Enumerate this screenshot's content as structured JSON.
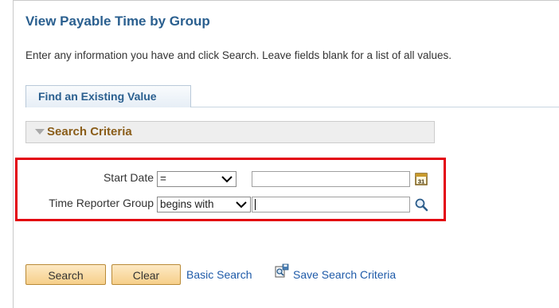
{
  "page": {
    "title": "View Payable Time by Group",
    "instructions": "Enter any information you have and click Search. Leave fields blank for a list of all values."
  },
  "tabs": [
    {
      "label": "Find an Existing Value",
      "active": true
    }
  ],
  "search_criteria": {
    "header": "Search Criteria",
    "fields": [
      {
        "label": "Start Date",
        "operator": "=",
        "value": "",
        "icon": "calendar-icon"
      },
      {
        "label": "Time Reporter Group",
        "operator": "begins with",
        "value": "",
        "icon": "lookup-magnifier-icon"
      }
    ]
  },
  "actions": {
    "search_label": "Search",
    "clear_label": "Clear",
    "basic_search_label": "Basic Search",
    "save_criteria_label": "Save Search Criteria",
    "save_criteria_icon": "save-criteria-icon"
  },
  "colors": {
    "title": "#2a5f8f",
    "section_header": "#8a5d19",
    "highlight_border": "#e3000f",
    "button_fill": "#f6cf8a",
    "link": "#1e5aa8"
  }
}
